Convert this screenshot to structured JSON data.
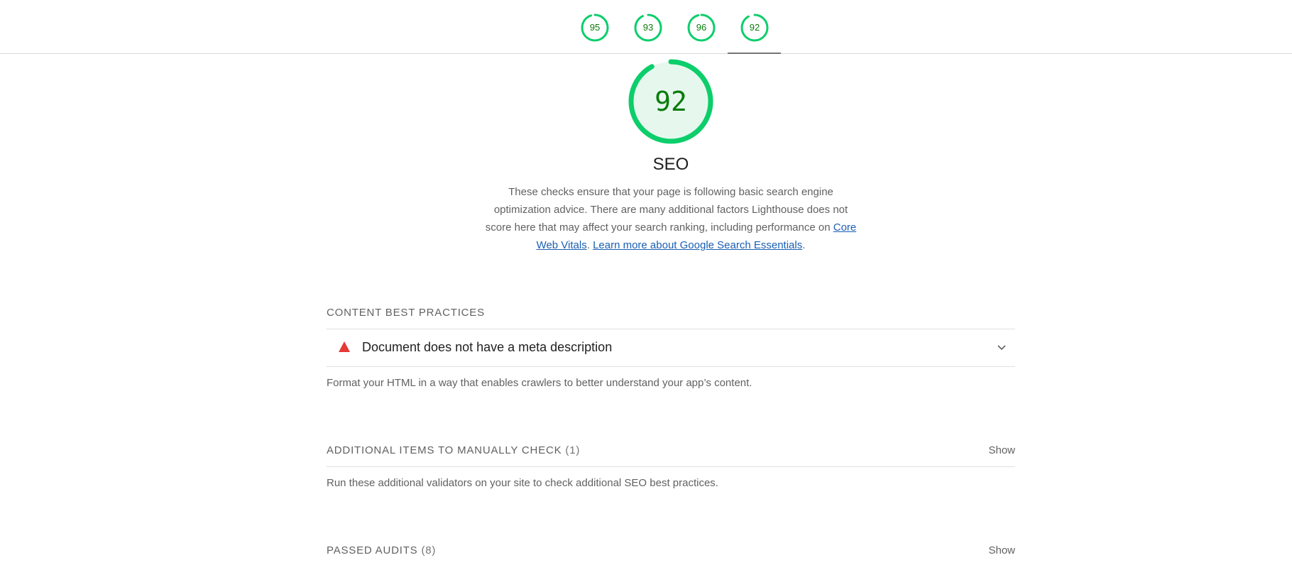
{
  "top_scores": [
    {
      "label": "95",
      "value": 95
    },
    {
      "label": "93",
      "value": 93
    },
    {
      "label": "96",
      "value": 96
    },
    {
      "label": "92",
      "value": 92
    }
  ],
  "category": {
    "score": "92",
    "score_value": 92,
    "title": "SEO",
    "description_prefix": "These checks ensure that your page is following basic search engine optimization advice. There are many additional factors Lighthouse does not score here that may affect your search ranking, including performance on ",
    "link_vitals": "Core Web Vitals",
    "separator": ". ",
    "link_search": "Learn more about Google Search Essentials",
    "description_suffix": "."
  },
  "groups": {
    "content": {
      "title": "CONTENT BEST PRACTICES",
      "audit_title": "Document does not have a meta description",
      "description": "Format your HTML in a way that enables crawlers to better understand your app’s content."
    },
    "manual": {
      "title": "ADDITIONAL ITEMS TO MANUALLY CHECK",
      "count": "(1)",
      "toggle": "Show",
      "description": "Run these additional validators on your site to check additional SEO best practices."
    },
    "passed": {
      "title": "PASSED AUDITS",
      "count": "(8)",
      "toggle": "Show"
    }
  },
  "colors": {
    "pass": "#0cce6b",
    "pass_text": "#0a7c0a",
    "fail": "#e53935",
    "link": "#1a5fb4"
  }
}
